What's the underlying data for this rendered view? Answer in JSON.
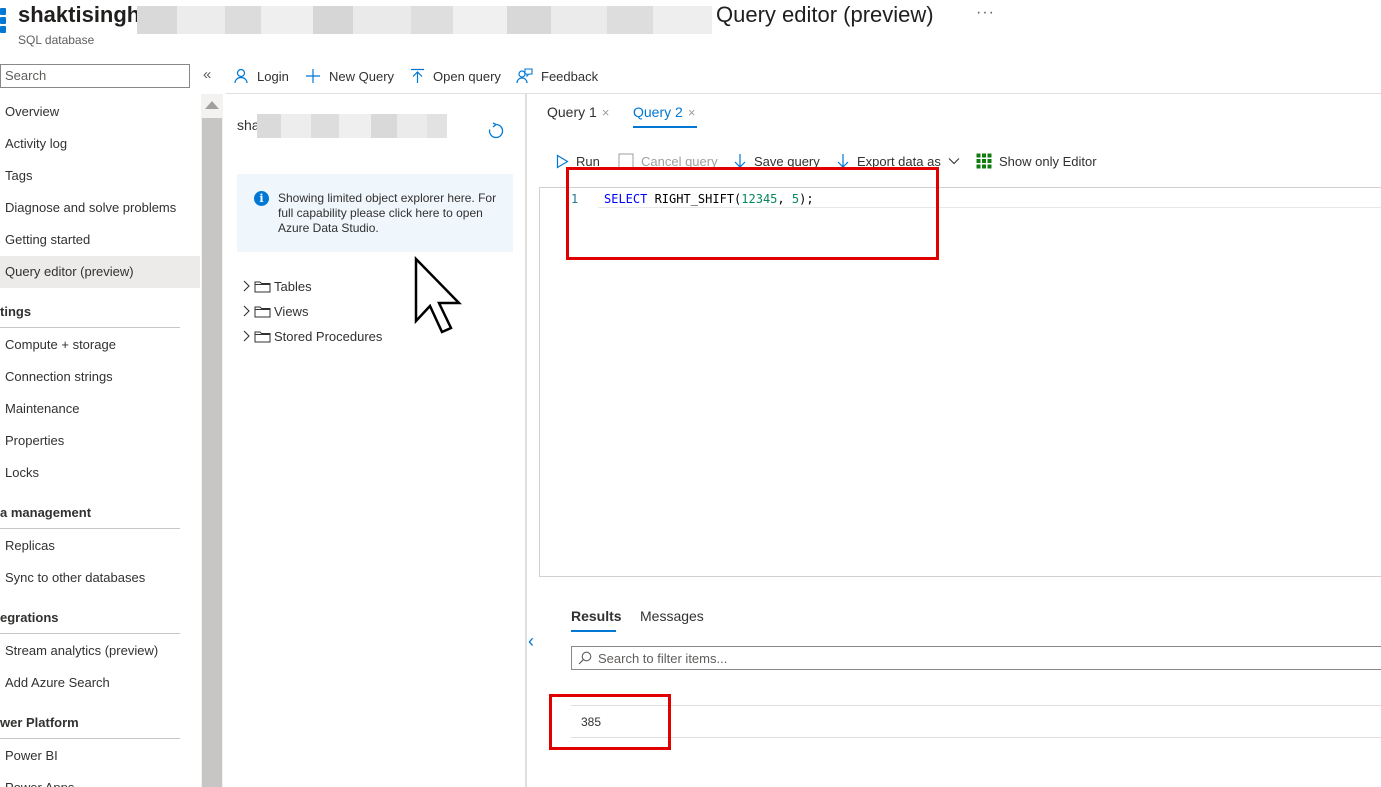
{
  "header": {
    "title": "shaktisingh",
    "title_tail": "Query editor (preview)",
    "more": "···",
    "subtitle": "SQL database"
  },
  "sidebar": {
    "search_placeholder": "Search",
    "collapse": "«",
    "items": [
      {
        "label": "Overview"
      },
      {
        "label": "Activity log"
      },
      {
        "label": "Tags"
      },
      {
        "label": "Diagnose and solve problems"
      },
      {
        "label": "Getting started"
      },
      {
        "label": "Query editor (preview)",
        "active": true
      }
    ],
    "sections": [
      {
        "title": "tings",
        "items": [
          "Compute + storage",
          "Connection strings",
          "Maintenance",
          "Properties",
          "Locks"
        ]
      },
      {
        "title": "a management",
        "items": [
          "Replicas",
          "Sync to other databases"
        ]
      },
      {
        "title": "egrations",
        "items": [
          "Stream analytics (preview)",
          "Add Azure Search"
        ]
      },
      {
        "title": "wer Platform",
        "items": [
          "Power BI",
          "Power Apps"
        ]
      }
    ]
  },
  "toolbar": {
    "login": "Login",
    "new_query": "New Query",
    "open_query": "Open query",
    "feedback": "Feedback"
  },
  "explorer": {
    "db_name_prefix": "sha",
    "info_text": "Showing limited object explorer here. For full capability please click here to open Azure Data Studio.",
    "tree": [
      "Tables",
      "Views",
      "Stored Procedures"
    ]
  },
  "tabs": [
    {
      "label": "Query 1",
      "close": "×"
    },
    {
      "label": "Query 2",
      "close": "×",
      "active": true
    }
  ],
  "editor_toolbar": {
    "run": "Run",
    "cancel": "Cancel query",
    "save": "Save query",
    "export": "Export data as",
    "show_only_editor": "Show only Editor"
  },
  "editor": {
    "line_number": "1",
    "kw": "SELECT",
    "fn": " RIGHT_SHIFT(",
    "arg1": "12345",
    "sep": ", ",
    "arg2": "5",
    "end": ");"
  },
  "results": {
    "tabs": [
      "Results",
      "Messages"
    ],
    "filter_placeholder": "Search to filter items...",
    "value": "385"
  },
  "colors": {
    "accent": "#0078d4",
    "highlight": "#e00000"
  }
}
